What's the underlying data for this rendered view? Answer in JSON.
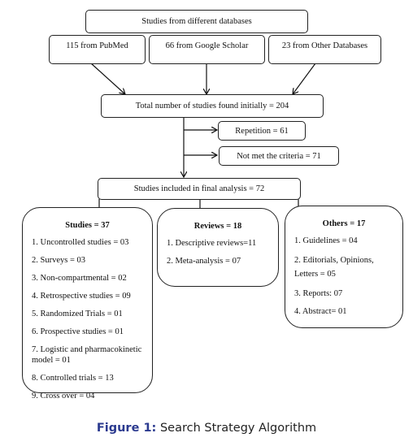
{
  "diagram": {
    "source_header": "Studies from different databases",
    "sources": [
      {
        "label": "115 from PubMed"
      },
      {
        "label": "66 from Google Scholar"
      },
      {
        "label": "23 from Other Databases"
      }
    ],
    "total": "Total number of studies found initially = 204",
    "exclusions": [
      {
        "label": "Repetition = 61"
      },
      {
        "label": "Not met the criteria = 71"
      }
    ],
    "included": "Studies included in final analysis = 72",
    "categories": {
      "studies": {
        "title": "Studies = 37",
        "items": [
          "1. Uncontrolled studies = 03",
          "2. Surveys = 03",
          "3. Non-compartmental = 02",
          "4. Retrospective studies = 09",
          "5. Randomized Trials = 01",
          "6. Prospective studies = 01",
          "7. Logistic and pharmacokinetic model = 01",
          "8. Controlled trials = 13",
          "9. Cross over = 04"
        ]
      },
      "reviews": {
        "title": "Reviews = 18",
        "items": [
          "1. Descriptive reviews=11",
          "2. Meta-analysis = 07"
        ]
      },
      "others": {
        "title": "Others = 17",
        "items": [
          "1. Guidelines = 04",
          "2. Editorials, Opinions, Letters = 05",
          "3. Reports: 07",
          "4. Abstract= 01"
        ]
      }
    }
  },
  "caption": {
    "label": "Figure 1:",
    "text": " Search Strategy Algorithm"
  }
}
